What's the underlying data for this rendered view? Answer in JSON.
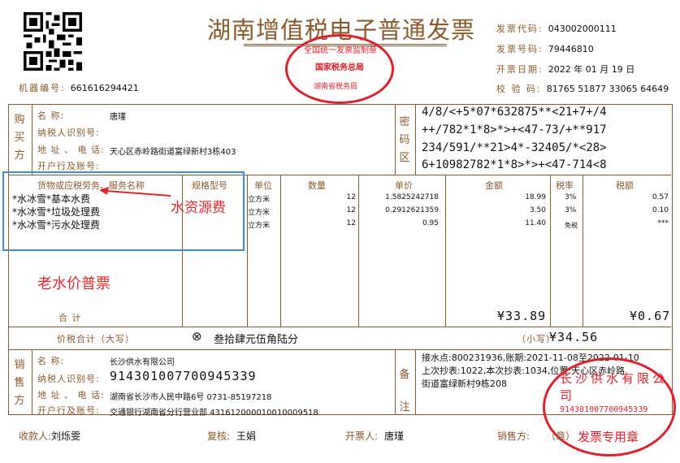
{
  "title": "湖南增值税电子普通发票",
  "machine_no": {
    "label": "机器编号:",
    "value": "661616294421"
  },
  "meta": [
    {
      "label": "发票代码:",
      "value": "043002000111"
    },
    {
      "label": "发票号码:",
      "value": "79446810"
    },
    {
      "label": "开票日期:",
      "value": "2022 年 01 月 19 日"
    },
    {
      "label": "校 验 码:",
      "value": "81765 51877 33065 64649"
    }
  ],
  "top_stamp": {
    "outer": "全国统一发票监制章",
    "middle": "国家税务总局",
    "bottom": "湖南省税务局"
  },
  "buyer": {
    "section_label": "购买方",
    "fields": [
      {
        "label": "名        称:",
        "value": "唐瑾"
      },
      {
        "label": "纳税人识别号:",
        "value": ""
      },
      {
        "label": "地 址 、 电 话:",
        "value": "天心区赤岭路街道富绿新村3栋403"
      },
      {
        "label": "开户行及账号:",
        "value": ""
      }
    ]
  },
  "cipher": {
    "label": "密码区",
    "lines": [
      "4/8/<+5*07*632875**<21+7+/4",
      "++/782*1*8>*>+<47-73/+**917",
      "234/591/**21>4*-32405/*<28>",
      "6+10982782*1*8>*>+<47-714<8"
    ]
  },
  "table_headers": {
    "name": "货物或应税劳务、服务名称",
    "spec": "规格型号",
    "unit": "单位",
    "qty": "数量",
    "price": "单价",
    "amount": "金额",
    "rate": "税率",
    "tax": "税额"
  },
  "items": [
    {
      "name": "*水冰雪*基本水费",
      "unit": "立方米",
      "qty": "12",
      "price": "1.5825242718",
      "amount": "18.99",
      "rate": "3%",
      "tax": "0.57"
    },
    {
      "name": "*水冰雪*垃圾处理费",
      "unit": "立方米",
      "qty": "12",
      "price": "0.2912621359",
      "amount": "3.50",
      "rate": "3%",
      "tax": "0.10"
    },
    {
      "name": "*水冰雪*污水处理费",
      "unit": "立方米",
      "qty": "12",
      "price": "0.95",
      "amount": "11.40",
      "rate": "免税",
      "tax": "***"
    }
  ],
  "annotations": {
    "water_resource": "水资源费",
    "old_price": "老水价普票"
  },
  "total": {
    "label": "合        计",
    "amount": "¥33.89",
    "tax": "¥0.67"
  },
  "grand_total": {
    "label": "价税合计（大写）",
    "upper_symbol": "⊗",
    "upper": "叁拾肆元伍角陆分",
    "lower_label": "（小写）",
    "lower": "¥34.56"
  },
  "seller": {
    "section_label": "销售方",
    "fields": [
      {
        "label": "名        称:",
        "value": "长沙供水有限公司"
      },
      {
        "label": "纳税人识别号:",
        "value": "914301007700945339"
      },
      {
        "label": "地 址 、 电 话:",
        "value": "湖南省长沙市人民中路6号 0731-85197218"
      },
      {
        "label": "开户行及账号:",
        "value": "交通银行湖南省分行营业部 431612000010010009518"
      }
    ]
  },
  "remarks": {
    "label": "备注",
    "lines": [
      "接水点:800231936,账期:2021-11-08至2022-01-10",
      "上次抄表:1022,本次抄表:1034,位置:天心区赤岭路",
      "街道富绿新村9栋208"
    ]
  },
  "seller_stamp": {
    "arc": "长沙供水有限公司",
    "number": "914301007700945339",
    "bottom": "发票专用章"
  },
  "footer": {
    "payee_label": "收款人:",
    "payee": "刘烁雯",
    "reviewer_label": "复核:",
    "reviewer": "王娟",
    "drawer_label": "开票人:",
    "drawer": "唐瑾",
    "seller_label": "销售方:",
    "seller_mark": "（章）"
  },
  "colors": {
    "frame": "#8a5a2c",
    "stamp": "#e0202a",
    "annotation": "#e02828",
    "highlight_box": "#3a8fe0"
  }
}
